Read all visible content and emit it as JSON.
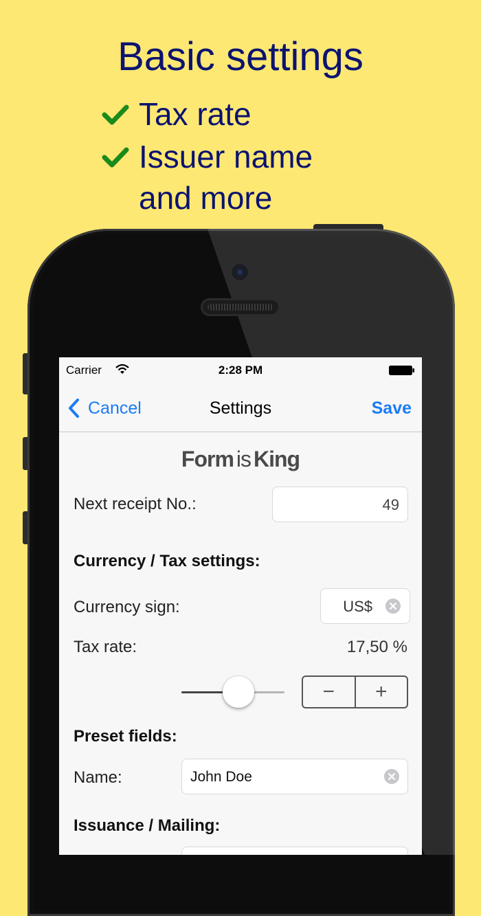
{
  "promo": {
    "title": "Basic settings",
    "bullets": [
      "Tax rate",
      "Issuer name"
    ],
    "bullet_continuation": "and more"
  },
  "status_bar": {
    "carrier": "Carrier",
    "time": "2:28 PM"
  },
  "nav": {
    "cancel_label": "Cancel",
    "title": "Settings",
    "save_label": "Save"
  },
  "brand": {
    "part1": "Form",
    "part2": "is",
    "part3": "King"
  },
  "receipt": {
    "label": "Next receipt No.:",
    "value": "49"
  },
  "currency_section": {
    "heading": "Currency / Tax settings:",
    "currency_label": "Currency sign:",
    "currency_value": "US$",
    "tax_label": "Tax rate:",
    "tax_value": "17,50 %",
    "slider_fraction": 0.55,
    "stepper_minus": "−",
    "stepper_plus": "+"
  },
  "preset_section": {
    "heading": "Preset fields:",
    "name_label": "Name:",
    "name_value": "John Doe"
  },
  "issuance_section": {
    "heading": "Issuance / Mailing:"
  },
  "colors": {
    "background": "#fde873",
    "promo_text": "#0c1370",
    "check": "#1a8a1a",
    "accent": "#1a7cf5"
  }
}
